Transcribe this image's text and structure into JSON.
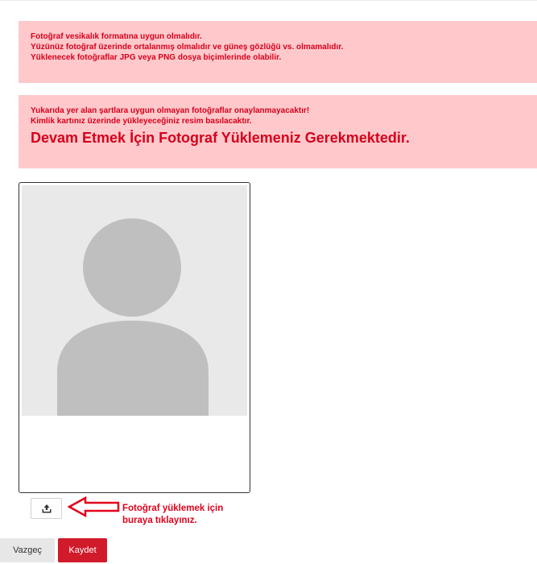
{
  "info_alert": {
    "lines": [
      "Fotoğraf vesikalık formatına uygun olmalıdır.",
      "Yüzünüz fotoğraf üzerinde ortalanmış olmalıdır ve güneş gözlüğü vs. olmamalıdır.",
      "Yüklenecek fotoğraflar JPG veya PNG dosya biçimlerinde olabilir."
    ]
  },
  "warning_alert": {
    "lines": [
      "Yukarıda yer alan şartlara uygun olmayan fotoğraflar onaylanmayacaktır!",
      "Kimlik kartınız üzerinde yükleyeceğiniz resim basılacaktır."
    ],
    "headline": "Devam Etmek İçin Fotograf Yüklemeniz Gerekmektedir."
  },
  "photo": {
    "placeholder_icon": "person-silhouette-icon"
  },
  "upload": {
    "icon": "upload-icon",
    "hint_line1": "Fotoğraf yüklemek için",
    "hint_line2": "buraya tıklayınız."
  },
  "actions": {
    "cancel_label": "Vazgeç",
    "save_label": "Kaydet"
  },
  "colors": {
    "alert_bg": "#ffc9cb",
    "alert_text": "#d6001c",
    "save_bg": "#d11a2a",
    "arrow": "#e3001b"
  }
}
